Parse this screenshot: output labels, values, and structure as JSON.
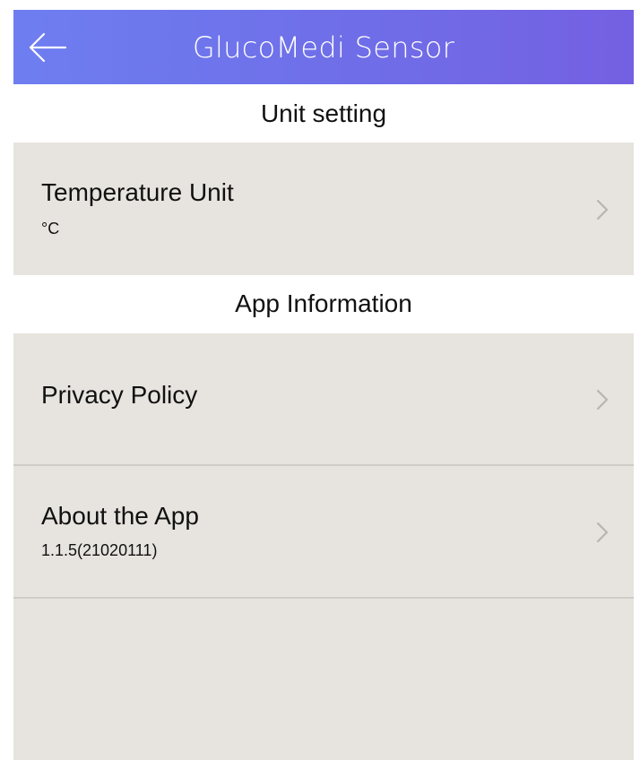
{
  "header": {
    "title": "GlucoMedi Sensor",
    "back_icon": "arrow-left-icon",
    "gradient_start": "#6e7ef0",
    "gradient_end": "#7460e2"
  },
  "sections": {
    "unit": {
      "title": "Unit setting",
      "items": [
        {
          "label": "Temperature Unit",
          "value": "°C",
          "icon": "chevron-right-icon"
        }
      ]
    },
    "app_info": {
      "title": "App Information",
      "items": [
        {
          "label": "Privacy Policy",
          "icon": "chevron-right-icon"
        },
        {
          "label": "About the App",
          "value": "1.1.5(21020111)",
          "icon": "chevron-right-icon"
        }
      ]
    }
  },
  "colors": {
    "list_background": "#e7e4df",
    "divider": "#cfccc8",
    "text": "#111111"
  }
}
